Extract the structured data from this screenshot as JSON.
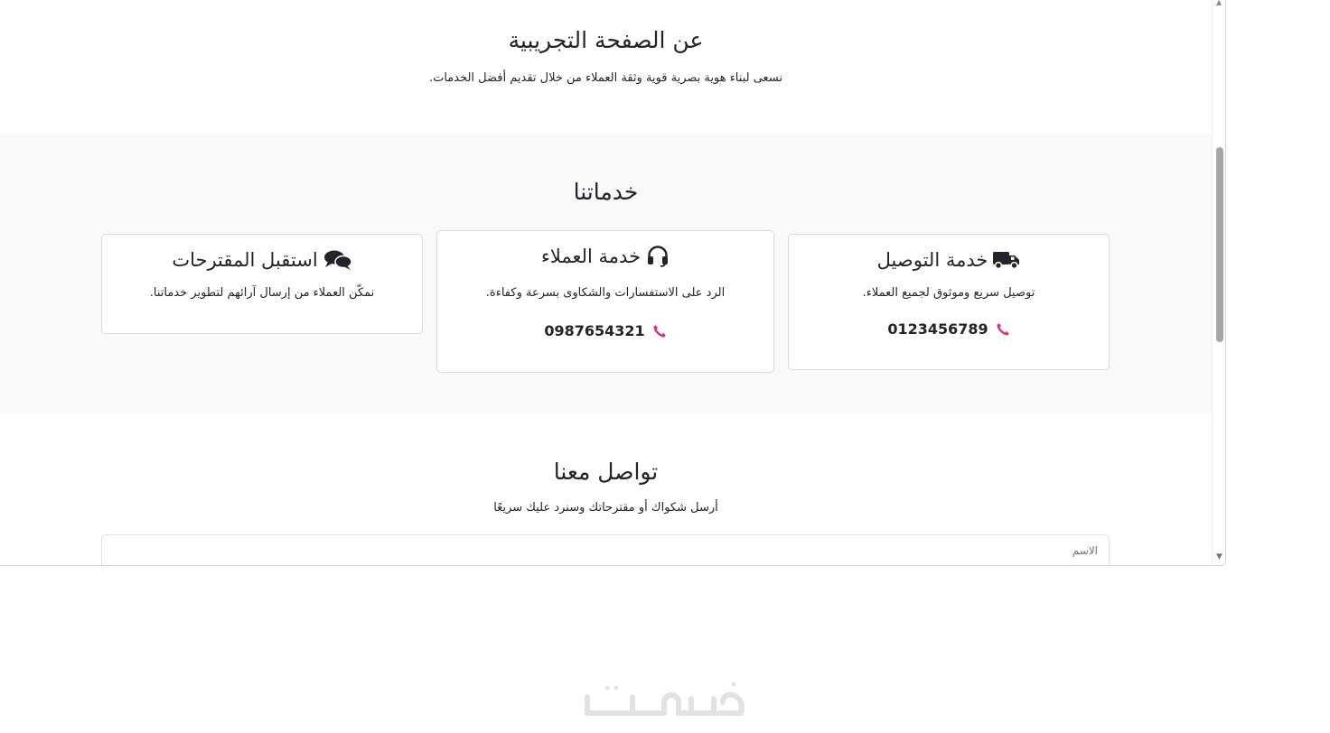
{
  "about": {
    "title": "عن الصفحة التجريبية",
    "text": "نسعى لبناء هوية بصرية قوية وثقة العملاء من خلال تقديم أفضل الخدمات."
  },
  "services": {
    "title": "خدماتنا",
    "cards": [
      {
        "title": "خدمة التوصيل",
        "icon": "truck-icon",
        "text": "توصيل سريع وموثوق لجميع العملاء.",
        "phone": "0123456789"
      },
      {
        "title": "خدمة العملاء",
        "icon": "headset-icon",
        "text": "الرد على الاستفسارات والشكاوى بسرعة وكفاءة.",
        "phone": "0987654321"
      },
      {
        "title": "استقبل المقترحات",
        "icon": "comments-icon",
        "text": "نمكّن العملاء من إرسال آرائهم لتطوير خدماتنا."
      }
    ],
    "phone_icon": "phone-icon",
    "accent_color": "#d63384"
  },
  "contact": {
    "title": "تواصل معنا",
    "text": "أرسل شكواك أو مقترحاتك وسنرد عليك سريعًا",
    "name_label": "الاسم"
  },
  "watermark": {
    "text": "خمسات"
  },
  "scrollbar": {
    "position_fraction": 0.39
  }
}
